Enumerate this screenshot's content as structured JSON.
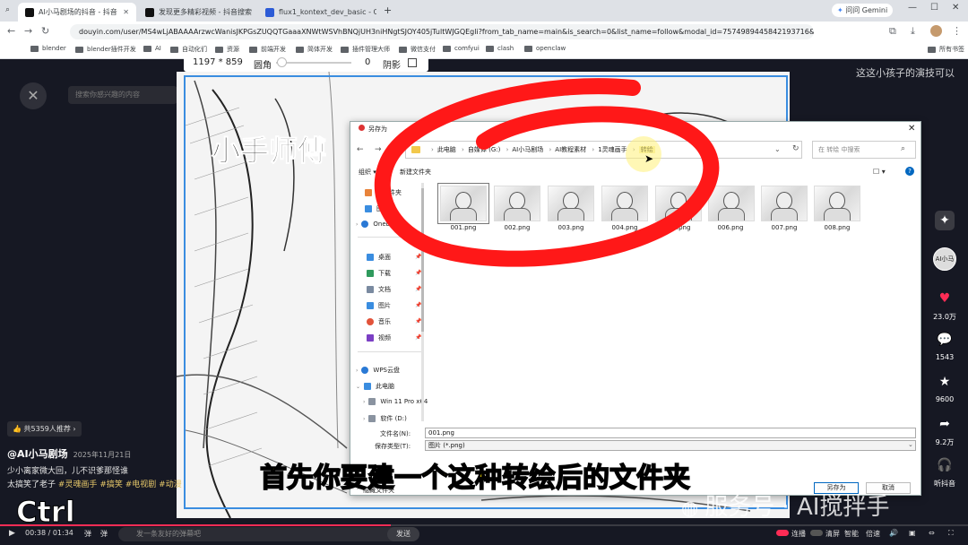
{
  "browser": {
    "tabs": [
      {
        "label": "AI小马剧场的抖音 - 抖音",
        "active": true
      },
      {
        "label": "发现更多精彩视频 - 抖音搜索",
        "active": false
      },
      {
        "label": "flux1_kontext_dev_basic - Co",
        "active": false
      }
    ],
    "gemini_label": "问问 Gemini",
    "url": "douyin.com/user/MS4wLjABAAAArzwcWanisJKPGsZUQQTGaaaXNWtWSVhBNQjUH3niHNgtSJOY405jTultWJGQEgli?from_tab_name=main&is_search=0&list_name=follow&modal_id=7574989445842193716&nt=0",
    "bookmarks": [
      "blender",
      "blender插件开发",
      "AI",
      "自动化们",
      "资源",
      "前端开发",
      "简体开发",
      "插件管理大师",
      "微信支付",
      "comfyui",
      "clash",
      "openclaw"
    ],
    "all_bookmarks": "所有书签"
  },
  "capture_toolbar": {
    "size": "1197 * 859",
    "radius_label": "圆角",
    "radius_value": "0",
    "shadow_label": "阴影"
  },
  "douyin": {
    "search_placeholder": "搜索你感兴趣的内容",
    "right_caption": "这这小孩子的演技可以",
    "recommend_tag": "共5359人推荐 ›",
    "author": "@AI小马剧场",
    "date": "2025年11月21日",
    "desc_line1": "少小离家微大回，儿不识爹那怪谁",
    "desc_line2_prefix": "太搞笑了老子",
    "tags": [
      "#灵魂画手",
      "#搞笑",
      "#电视剧",
      "#动漫"
    ],
    "subtitle": "首先你要建一个这种转绘后的文件夹",
    "watermark": "服务号 · AI搅拌手",
    "ctrl_key": "Ctrl",
    "actions": [
      {
        "icon": "star-icon",
        "label": ""
      },
      {
        "icon": "heart-icon",
        "label": "23.0万"
      },
      {
        "icon": "comment-icon",
        "label": "1543"
      },
      {
        "icon": "favorite-icon",
        "label": "9600"
      },
      {
        "icon": "share-icon",
        "label": "9.2万"
      },
      {
        "icon": "headphones-icon",
        "label": "听抖音"
      }
    ],
    "avatar_text": "AI小马",
    "colors": {
      "like": "#fe2c55",
      "accent": "#ffe600",
      "tag": "#e8c96a"
    }
  },
  "video_frame": {
    "title_text": "小手师傅"
  },
  "save_dialog": {
    "title": "另存为",
    "breadcrumb": [
      "此电脑",
      "自媒体 (G:)",
      "AI小马剧场",
      "AI教程素材",
      "1灵魂画手",
      "转绘"
    ],
    "search_placeholder": "在 转绘 中搜索",
    "organize": "组织 ▾",
    "new_folder": "新建文件夹",
    "sidebar": [
      {
        "label": "主文件夹",
        "icon": "home-icon",
        "pin": false
      },
      {
        "label": "图库",
        "icon": "gallery-icon",
        "pin": false
      },
      {
        "label": "OneDrive",
        "icon": "cloud-icon",
        "pin": false
      },
      {
        "label": "桌面",
        "icon": "desktop-icon",
        "pin": true
      },
      {
        "label": "下载",
        "icon": "download-icon",
        "pin": true
      },
      {
        "label": "文档",
        "icon": "document-icon",
        "pin": true
      },
      {
        "label": "图片",
        "icon": "picture-icon",
        "pin": true
      },
      {
        "label": "音乐",
        "icon": "music-icon",
        "pin": true
      },
      {
        "label": "视频",
        "icon": "video-icon",
        "pin": true
      },
      {
        "label": "WPS云盘",
        "icon": "cloud-icon",
        "pin": false
      },
      {
        "label": "此电脑",
        "icon": "computer-icon",
        "pin": false
      },
      {
        "label": "Win 11 Pro x64",
        "icon": "drive-icon",
        "pin": false
      },
      {
        "label": "软件 (D:)",
        "icon": "drive-icon",
        "pin": false
      }
    ],
    "files": [
      "001.png",
      "002.png",
      "003.png",
      "004.png",
      "005.png",
      "006.png",
      "007.png",
      "008.png"
    ],
    "filename_label": "文件名(N):",
    "filename_value": "001.png",
    "filetype_label": "保存类型(T):",
    "filetype_value": "图片 (*.png)",
    "hide_folders": "隐藏文件夹",
    "save_button": "另存为",
    "cancel_button": "取消"
  },
  "player": {
    "time": "00:38 / 01:34",
    "progress": 0.404,
    "danmu_a": "弹",
    "danmu_b": "弹",
    "danmu_placeholder": "发一条友好的弹幕吧",
    "send": "发送",
    "options": [
      "连播",
      "清屏",
      "智能",
      "倍速"
    ]
  }
}
